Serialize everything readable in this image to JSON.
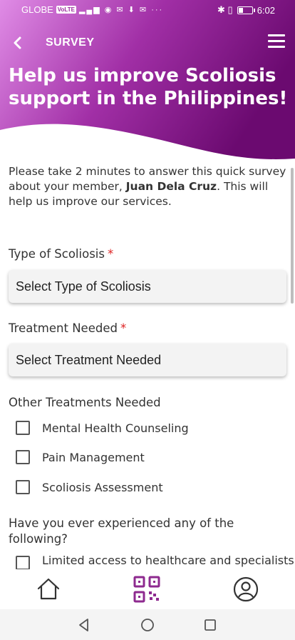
{
  "status_bar": {
    "carrier": "GLOBE",
    "network_badge": "VoLTE",
    "time": "6:02",
    "battery_percent": 35
  },
  "app_bar": {
    "title": "SURVEY"
  },
  "header": {
    "headline": "Help us improve Scoliosis support in the Philippines!",
    "gradient_start": "#e08ce6",
    "gradient_end": "#6b0a70"
  },
  "intro": {
    "text_before": "Please take 2 minutes to answer this quick survey about your member, ",
    "member_name": "Juan Dela Cruz",
    "text_after": ". This will help us improve our services."
  },
  "form": {
    "type_of_scoliosis": {
      "label": "Type of Scoliosis",
      "required_mark": "*",
      "placeholder": "Select Type of Scoliosis"
    },
    "treatment_needed": {
      "label": "Treatment Needed",
      "required_mark": "*",
      "placeholder": "Select Treatment Needed"
    },
    "other_treatments": {
      "label": "Other Treatments Needed",
      "options": [
        "Mental Health Counseling",
        "Pain Management",
        "Scoliosis Assessment"
      ]
    },
    "experience_question": {
      "label": "Have you ever experienced any of the following?",
      "first_option": "Limited access to healthcare and specialists"
    }
  },
  "bottom_nav": {
    "items": [
      "home-icon",
      "qr-code-icon",
      "profile-icon"
    ],
    "accent_color": "#8e2a8f"
  }
}
